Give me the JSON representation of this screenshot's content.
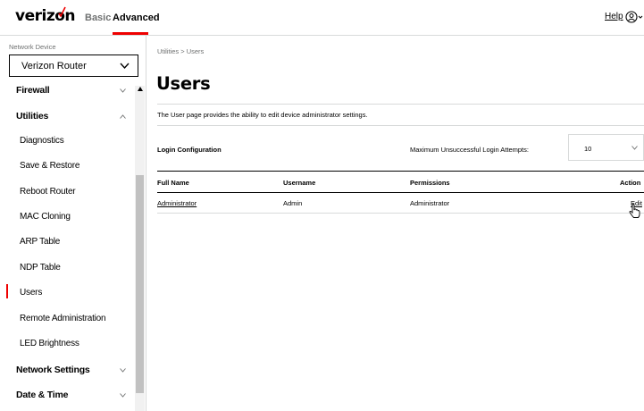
{
  "header": {
    "logo": "verizon",
    "tabs": [
      {
        "label": "Basic",
        "active": false
      },
      {
        "label": "Advanced",
        "active": true
      }
    ],
    "help_label": "Help",
    "account_icon": "account-circle-icon",
    "accent_color": "#ee0000"
  },
  "sidebar": {
    "network_device_label": "Network Device",
    "network_device_value": "Verizon Router",
    "items": [
      {
        "label": "Firewall",
        "type": "section",
        "chevron": "down"
      },
      {
        "label": "Utilities",
        "type": "section",
        "chevron": "up"
      },
      {
        "label": "Diagnostics",
        "type": "sub"
      },
      {
        "label": "Save & Restore",
        "type": "sub"
      },
      {
        "label": "Reboot Router",
        "type": "sub"
      },
      {
        "label": "MAC Cloning",
        "type": "sub"
      },
      {
        "label": "ARP Table",
        "type": "sub"
      },
      {
        "label": "NDP Table",
        "type": "sub"
      },
      {
        "label": "Users",
        "type": "sub",
        "active": true
      },
      {
        "label": "Remote Administration",
        "type": "sub"
      },
      {
        "label": "LED Brightness",
        "type": "sub"
      },
      {
        "label": "Network Settings",
        "type": "section",
        "chevron": "down"
      },
      {
        "label": "Date & Time",
        "type": "section",
        "chevron": "down"
      }
    ]
  },
  "main": {
    "breadcrumb": "Utilities  >  Users",
    "title": "Users",
    "description": "The User page provides the ability to edit device administrator settings.",
    "login_configuration_label": "Login Configuration",
    "max_attempts_label": "Maximum Unsuccessful Login Attempts:",
    "max_attempts_value": "10",
    "table": {
      "headers": [
        "Full Name",
        "Username",
        "Permissions",
        "Action"
      ],
      "rows": [
        {
          "full_name": "Administrator",
          "username": "Admin",
          "permissions": "Administrator",
          "action": "Edit"
        }
      ]
    }
  }
}
